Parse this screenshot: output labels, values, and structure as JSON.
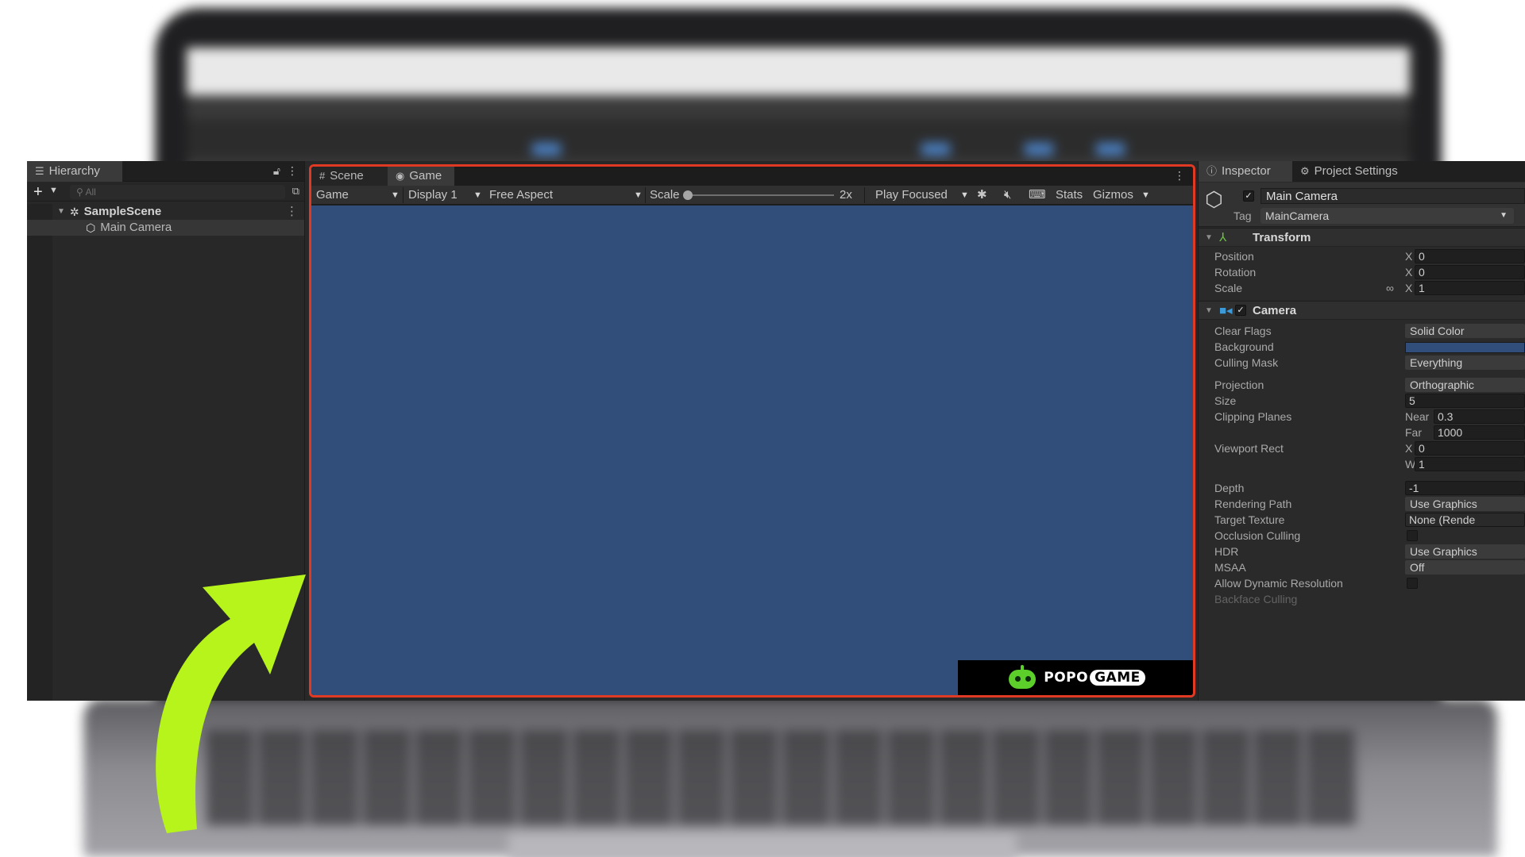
{
  "hierarchy": {
    "tab_label": "Hierarchy",
    "search_placeholder": "All",
    "scene_name": "SampleScene",
    "items": [
      {
        "label": "Main Camera"
      }
    ]
  },
  "game": {
    "tabs": [
      {
        "label": "Scene"
      },
      {
        "label": "Game"
      }
    ],
    "toolbar": {
      "mode": "Game",
      "display": "Display 1",
      "aspect": "Free Aspect",
      "scale_label": "Scale",
      "scale_value": "2x",
      "scale_fraction": 0.0,
      "play_mode": "Play Focused",
      "stats": "Stats",
      "gizmos": "Gizmos"
    },
    "background_color": "#314d79",
    "highlight_color": "#e03a25",
    "logo": {
      "part1": "POPO",
      "part2": "GAME"
    }
  },
  "inspector": {
    "tabs": [
      {
        "label": "Inspector"
      },
      {
        "label": "Project Settings"
      }
    ],
    "object_name": "Main Camera",
    "object_enabled": true,
    "tag_label": "Tag",
    "tag_value": "MainCamera",
    "transform": {
      "title": "Transform",
      "position": {
        "label": "Position",
        "axis": "X",
        "value": "0"
      },
      "rotation": {
        "label": "Rotation",
        "axis": "X",
        "value": "0"
      },
      "scale": {
        "label": "Scale",
        "axis": "X",
        "value": "1"
      }
    },
    "camera": {
      "title": "Camera",
      "enabled": true,
      "clear_flags": {
        "label": "Clear Flags",
        "value": "Solid Color"
      },
      "background": {
        "label": "Background",
        "color": "#314d79"
      },
      "culling_mask": {
        "label": "Culling Mask",
        "value": "Everything"
      },
      "projection": {
        "label": "Projection",
        "value": "Orthographic"
      },
      "size": {
        "label": "Size",
        "value": "5"
      },
      "clipping": {
        "label": "Clipping Planes",
        "near_label": "Near",
        "near": "0.3",
        "far_label": "Far",
        "far": "1000"
      },
      "viewport": {
        "label": "Viewport Rect",
        "x_label": "X",
        "x": "0",
        "w_label": "W",
        "w": "1"
      },
      "depth": {
        "label": "Depth",
        "value": "-1"
      },
      "rendering_path": {
        "label": "Rendering Path",
        "value": "Use Graphics"
      },
      "target_texture": {
        "label": "Target Texture",
        "value": "None (Rende"
      },
      "occlusion_culling": {
        "label": "Occlusion Culling"
      },
      "hdr": {
        "label": "HDR",
        "value": "Use Graphics"
      },
      "msaa": {
        "label": "MSAA",
        "value": "Off"
      },
      "dynamic_resolution": {
        "label": "Allow Dynamic Resolution"
      },
      "backface": {
        "label": "Backface Culling"
      }
    }
  },
  "overlay": {
    "arrow_color": "#b6f41b"
  }
}
